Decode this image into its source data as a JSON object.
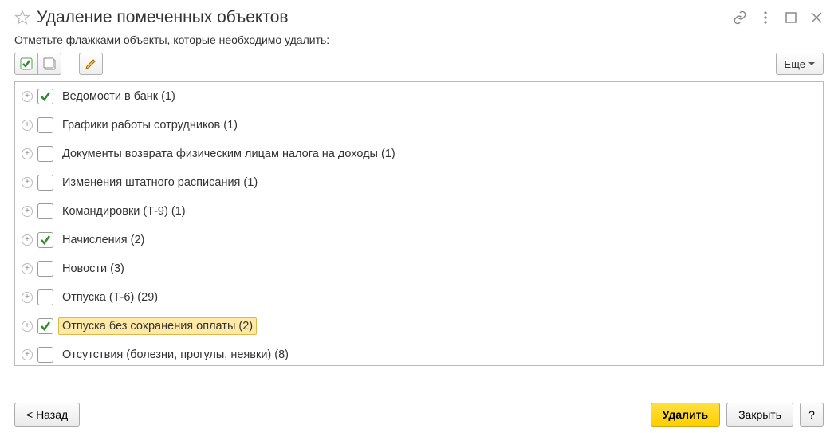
{
  "header": {
    "title": "Удаление помеченных объектов"
  },
  "subtitle": "Отметьте флажками объекты, которые необходимо удалить:",
  "toolbar": {
    "more_label": "Еще"
  },
  "items": [
    {
      "label": "Ведомости в банк (1)",
      "checked": true,
      "highlighted": false
    },
    {
      "label": "Графики работы сотрудников (1)",
      "checked": false,
      "highlighted": false
    },
    {
      "label": "Документы возврата физическим лицам налога на доходы (1)",
      "checked": false,
      "highlighted": false
    },
    {
      "label": "Изменения штатного расписания (1)",
      "checked": false,
      "highlighted": false
    },
    {
      "label": "Командировки (Т-9) (1)",
      "checked": false,
      "highlighted": false
    },
    {
      "label": "Начисления (2)",
      "checked": true,
      "highlighted": false
    },
    {
      "label": "Новости (3)",
      "checked": false,
      "highlighted": false
    },
    {
      "label": "Отпуска (Т-6) (29)",
      "checked": false,
      "highlighted": false
    },
    {
      "label": "Отпуска без сохранения оплаты (2)",
      "checked": true,
      "highlighted": true
    },
    {
      "label": "Отсутствия (болезни, прогулы, неявки) (8)",
      "checked": false,
      "highlighted": false
    }
  ],
  "footer": {
    "back_label": "< Назад",
    "delete_label": "Удалить",
    "close_label": "Закрыть",
    "help_label": "?"
  }
}
